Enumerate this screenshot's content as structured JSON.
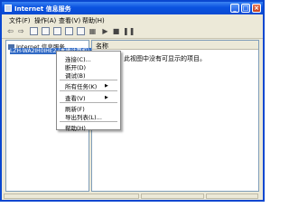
{
  "window": {
    "title": "Internet 信息服务"
  },
  "titlebar_buttons": {
    "minimize": "_",
    "maximize": "□",
    "close": "×"
  },
  "menubar": {
    "items": [
      "文件(F)",
      "操作(A)",
      "查看(V)",
      "帮助(H)"
    ]
  },
  "toolbar": {
    "tools": [
      "back-icon",
      "forward-icon",
      "up-icon",
      "properties-icon",
      "refresh-icon",
      "export-icon",
      "help-icon",
      "computer-icon",
      "play-icon",
      "stop-icon",
      "pause-icon"
    ]
  },
  "tree": {
    "root_label": "Internet 信息服务",
    "selected_label": "LZH-WA2IH0IHE2 (本地计算机)"
  },
  "list": {
    "column_name": "名称",
    "empty_message": "此视图中没有可显示的项目。"
  },
  "context_menu": {
    "items": [
      {
        "label": "连接(C)...",
        "submenu": false
      },
      {
        "label": "断开(D)",
        "submenu": false
      },
      {
        "label": "调试(B)",
        "submenu": false
      },
      {
        "label": "所有任务(K)",
        "submenu": true
      },
      {
        "label": "查看(V)",
        "submenu": true
      },
      {
        "label": "刷新(F)",
        "submenu": false
      },
      {
        "label": "导出列表(L)...",
        "submenu": false
      },
      {
        "label": "帮助(H)",
        "submenu": false
      }
    ],
    "submenu_arrow": "▶"
  },
  "colors": {
    "title_bar": "#0a52e0",
    "selection": "#316ac5",
    "chrome": "#ece9d8"
  }
}
